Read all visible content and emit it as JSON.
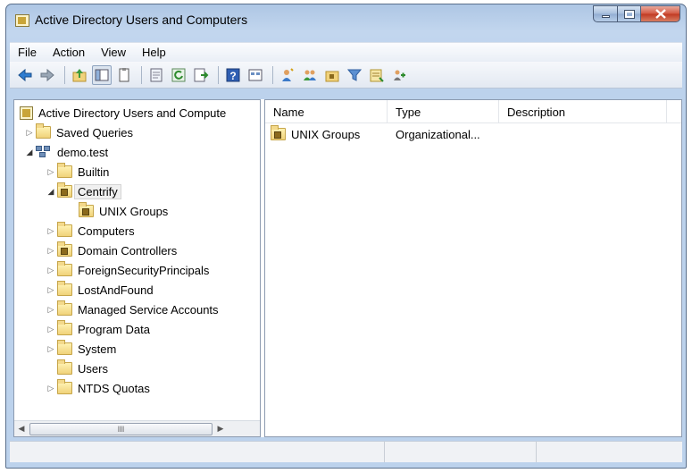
{
  "window": {
    "title": "Active Directory Users and Computers"
  },
  "menu": [
    "File",
    "Action",
    "View",
    "Help"
  ],
  "toolbar": {
    "icons": [
      "back-arrow-icon",
      "forward-arrow-icon",
      "up-folder-icon",
      "show-hide-console-tree-icon",
      "copy-icon",
      "properties-icon",
      "refresh-icon",
      "export-list-icon",
      "help-icon",
      "view-icon",
      "new-user-icon",
      "new-group-icon",
      "new-ou-icon",
      "filter-icon",
      "find-icon",
      "add-to-group-icon"
    ]
  },
  "tree": {
    "root": "Active Directory Users and Compute",
    "items": [
      {
        "label": "Saved Queries",
        "indent": 1,
        "arrow": "collapsed",
        "icon": "folder"
      },
      {
        "label": "demo.test",
        "indent": 1,
        "arrow": "expanded",
        "icon": "domain"
      },
      {
        "label": "Builtin",
        "indent": 2,
        "arrow": "collapsed",
        "icon": "folder"
      },
      {
        "label": "Centrify",
        "indent": 2,
        "arrow": "expanded",
        "icon": "ou",
        "selected": true
      },
      {
        "label": "UNIX Groups",
        "indent": 3,
        "arrow": "none",
        "icon": "ou"
      },
      {
        "label": "Computers",
        "indent": 2,
        "arrow": "collapsed",
        "icon": "folder"
      },
      {
        "label": "Domain Controllers",
        "indent": 2,
        "arrow": "collapsed",
        "icon": "ou"
      },
      {
        "label": "ForeignSecurityPrincipals",
        "indent": 2,
        "arrow": "collapsed",
        "icon": "folder"
      },
      {
        "label": "LostAndFound",
        "indent": 2,
        "arrow": "collapsed",
        "icon": "folder"
      },
      {
        "label": "Managed Service Accounts",
        "indent": 2,
        "arrow": "collapsed",
        "icon": "folder"
      },
      {
        "label": "Program Data",
        "indent": 2,
        "arrow": "collapsed",
        "icon": "folder"
      },
      {
        "label": "System",
        "indent": 2,
        "arrow": "collapsed",
        "icon": "folder"
      },
      {
        "label": "Users",
        "indent": 2,
        "arrow": "none",
        "icon": "folder"
      },
      {
        "label": "NTDS Quotas",
        "indent": 2,
        "arrow": "collapsed",
        "icon": "folder"
      }
    ],
    "scroll_thumb_glyph": "III"
  },
  "list": {
    "columns": [
      "Name",
      "Type",
      "Description"
    ],
    "rows": [
      {
        "name": "UNIX Groups",
        "type": "Organizational...",
        "description": ""
      }
    ]
  }
}
